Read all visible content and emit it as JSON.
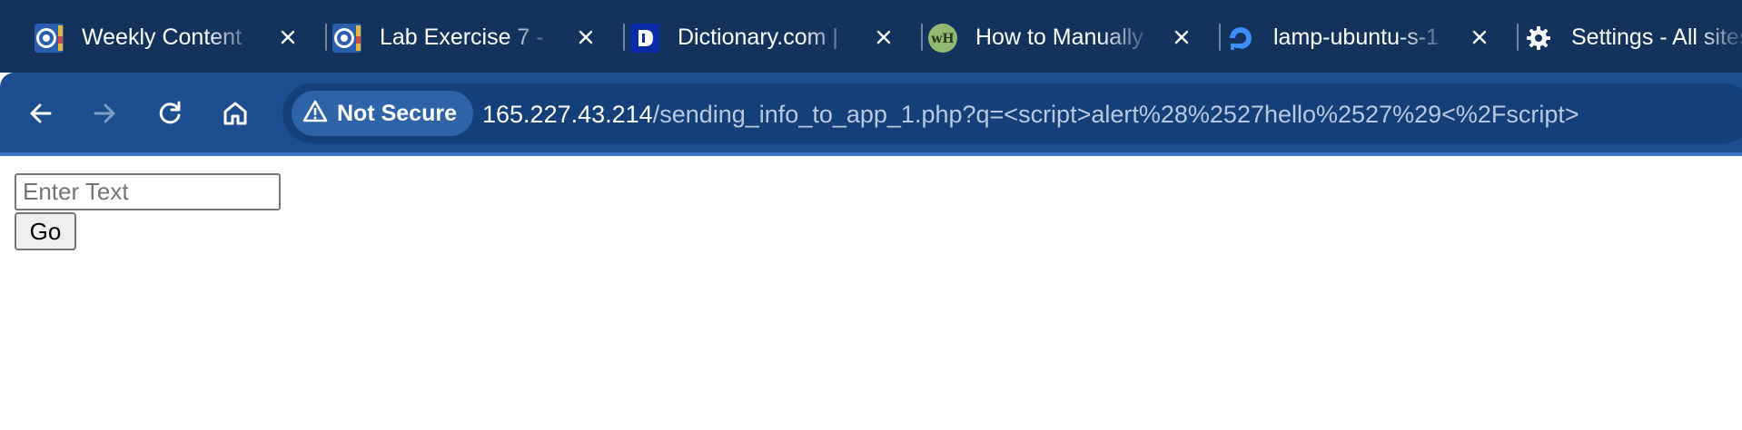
{
  "tabs": [
    {
      "title": "Weekly Content",
      "favicon": "georgetown-seal-icon"
    },
    {
      "title": "Lab Exercise 7 -",
      "favicon": "georgetown-seal-icon"
    },
    {
      "title": "Dictionary.com |",
      "favicon": "dictionary-logo-icon"
    },
    {
      "title": "How to Manually",
      "favicon": "wikihow-logo-icon",
      "favicon_text": "wH"
    },
    {
      "title": "lamp-ubuntu-s-1",
      "favicon": "digitalocean-logo-icon"
    },
    {
      "title": "Settings - All sites",
      "favicon": "gear-icon"
    }
  ],
  "toolbar": {
    "back_icon": "back-arrow-icon",
    "forward_icon": "forward-arrow-icon",
    "reload_icon": "reload-icon",
    "home_icon": "home-icon"
  },
  "omnibox": {
    "security_label": "Not Secure",
    "security_icon": "warning-triangle-icon",
    "url_host": "165.227.43.214",
    "url_path": "/sending_info_to_app_1.php?q=<script>alert%28%2527hello%2527%29<%2Fscript>"
  },
  "page": {
    "input_value": "",
    "input_placeholder": "Enter Text",
    "go_label": "Go"
  },
  "colors": {
    "tabstrip_bg": "#13335d",
    "toolbar_bg": "#1c4e8f",
    "omnibox_bg": "#153f78",
    "chip_bg": "#2f63a8"
  }
}
